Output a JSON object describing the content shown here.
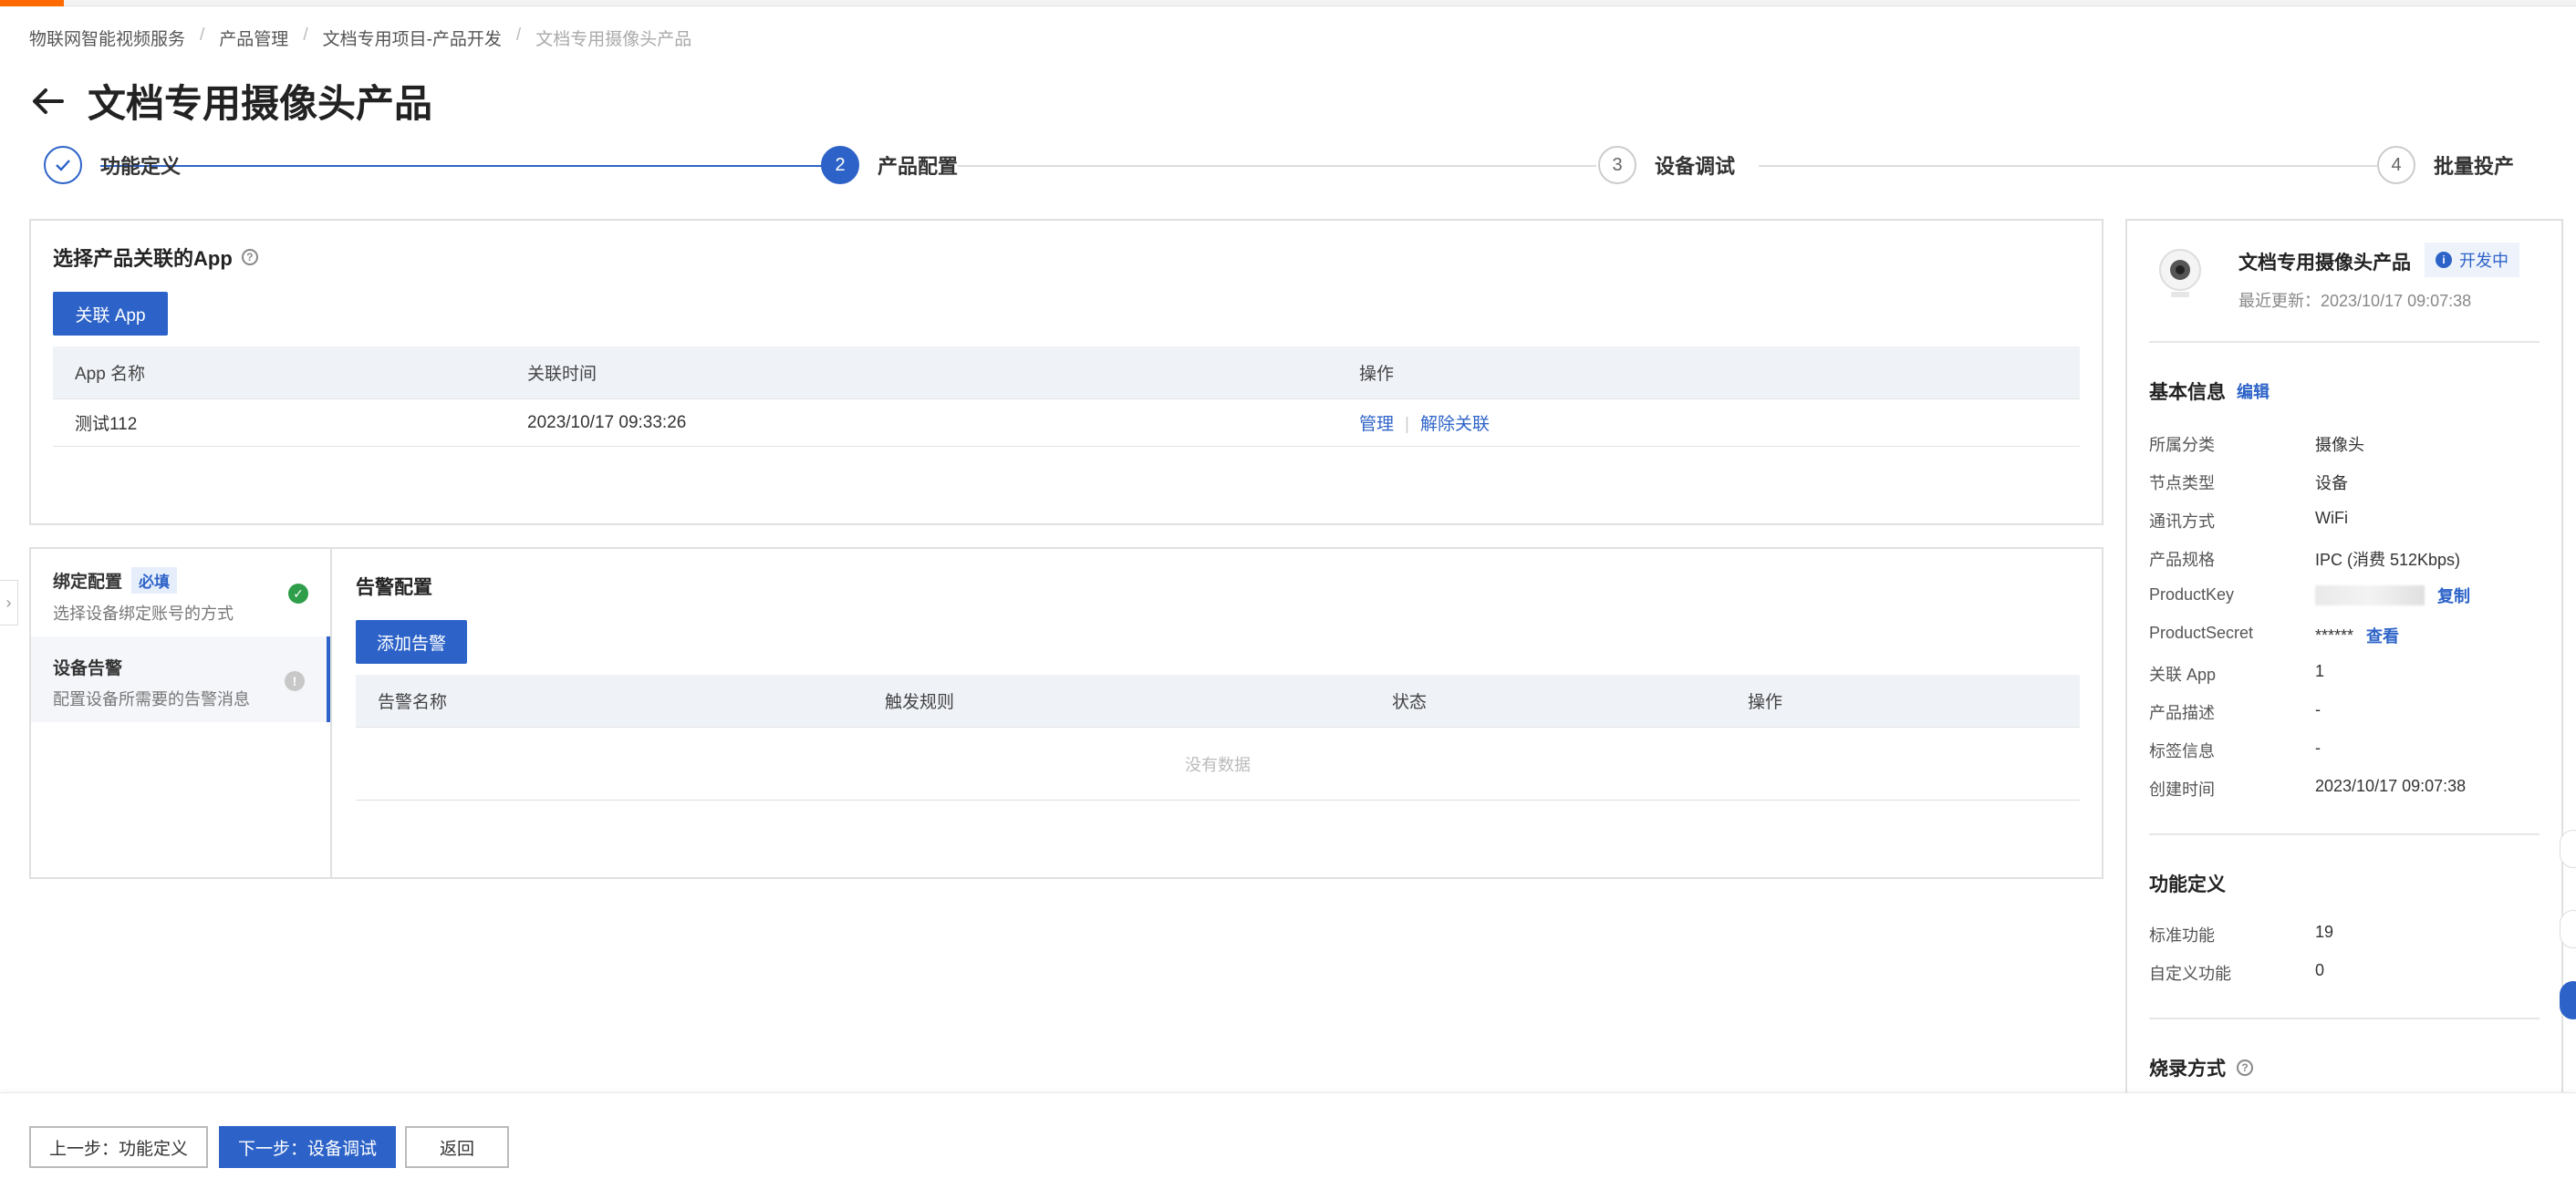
{
  "breadcrumb": [
    "物联网智能视频服务",
    "产品管理",
    "文档专用项目-产品开发",
    "文档专用摄像头产品"
  ],
  "page_title": "文档专用摄像头产品",
  "steps": [
    {
      "num": "✓",
      "label": "功能定义",
      "state": "done"
    },
    {
      "num": "2",
      "label": "产品配置",
      "state": "active"
    },
    {
      "num": "3",
      "label": "设备调试",
      "state": "pending"
    },
    {
      "num": "4",
      "label": "批量投产",
      "state": "pending"
    }
  ],
  "app_section": {
    "title": "选择产品关联的App",
    "link_button": "关联 App",
    "columns": [
      "App 名称",
      "关联时间",
      "操作"
    ],
    "rows": [
      {
        "name": "测试112",
        "time": "2023/10/17 09:33:26",
        "actions": [
          "管理",
          "解除关联"
        ]
      }
    ]
  },
  "side_menu": [
    {
      "title": "绑定配置",
      "badge": "必填",
      "desc": "选择设备绑定账号的方式"
    },
    {
      "title": "设备告警",
      "badge": "",
      "desc": "配置设备所需要的告警消息"
    }
  ],
  "alarm_section": {
    "title": "告警配置",
    "add_button": "添加告警",
    "columns": [
      "告警名称",
      "触发规则",
      "状态",
      "操作"
    ],
    "empty_text": "没有数据"
  },
  "info_panel": {
    "product_name": "文档专用摄像头产品",
    "status_badge": "开发中",
    "last_update": "最近更新：2023/10/17 09:07:38",
    "basic_title": "基本信息",
    "edit_label": "编辑",
    "basic": [
      {
        "key": "所属分类",
        "value": "摄像头"
      },
      {
        "key": "节点类型",
        "value": "设备"
      },
      {
        "key": "通讯方式",
        "value": "WiFi"
      },
      {
        "key": "产品规格",
        "value": "IPC (消费 512Kbps)"
      },
      {
        "key": "ProductKey",
        "value": "",
        "action": "复制"
      },
      {
        "key": "ProductSecret",
        "value": "******",
        "action": "查看"
      },
      {
        "key": "关联 App",
        "value": "1"
      },
      {
        "key": "产品描述",
        "value": "-"
      },
      {
        "key": "标签信息",
        "value": "-"
      },
      {
        "key": "创建时间",
        "value": "2023/10/17 09:07:38"
      }
    ],
    "func_title": "功能定义",
    "func": [
      {
        "key": "标准功能",
        "value": "19"
      },
      {
        "key": "自定义功能",
        "value": "0"
      }
    ],
    "burn_title": "烧录方式"
  },
  "footer": {
    "prev": "上一步：功能定义",
    "next": "下一步：设备调试",
    "back": "返回"
  },
  "colors": {
    "primary": "#2d63c8",
    "success": "#2e9e4a",
    "brand": "#ff6a00"
  }
}
